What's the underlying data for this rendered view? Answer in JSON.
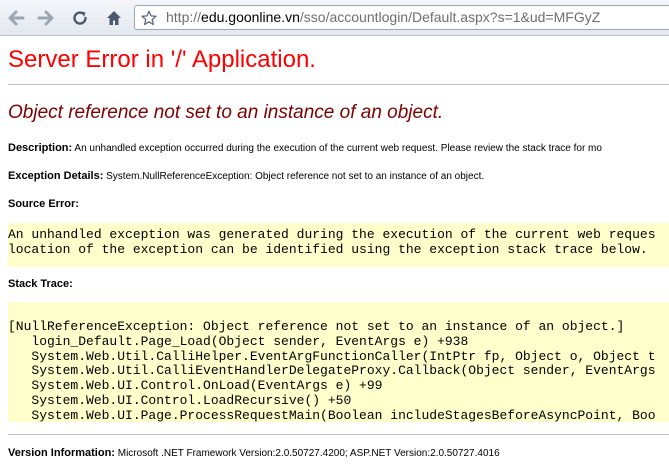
{
  "browser": {
    "url_protocol": "http://",
    "url_host": "edu.goonline.vn",
    "url_path": "/sso/accountlogin/Default.aspx?s=1&ud=MFGyZ"
  },
  "page": {
    "title": "Server Error in '/' Application.",
    "error_message": "Object reference not set to an instance of an object.",
    "description_label": "Description:",
    "description_text": "An unhandled exception occurred during the execution of the current web request. Please review the stack trace for mo",
    "exception_label": "Exception Details:",
    "exception_text": "System.NullReferenceException: Object reference not set to an instance of an object.",
    "source_error_label": "Source Error:",
    "source_error_lines": [
      "An unhandled exception was generated during the execution of the current web reques",
      "location of the exception can be identified using the exception stack trace below."
    ],
    "stack_trace_label": "Stack Trace:",
    "stack_trace_lines": [
      "[NullReferenceException: Object reference not set to an instance of an object.]",
      "   login_Default.Page_Load(Object sender, EventArgs e) +938",
      "   System.Web.Util.CalliHelper.EventArgFunctionCaller(IntPtr fp, Object o, Object t",
      "   System.Web.Util.CalliEventHandlerDelegateProxy.Callback(Object sender, EventArgs",
      "   System.Web.UI.Control.OnLoad(EventArgs e) +99",
      "   System.Web.UI.Control.LoadRecursive() +50",
      "   System.Web.UI.Page.ProcessRequestMain(Boolean includeStagesBeforeAsyncPoint, Boo"
    ],
    "version_label": "Version Information:",
    "version_text": "Microsoft .NET Framework Version:2.0.50727.4200; ASP.NET Version:2.0.50727.4016"
  },
  "colors": {
    "title": "#ff0000",
    "error_message": "#800000",
    "code_background": "#ffffcc"
  }
}
